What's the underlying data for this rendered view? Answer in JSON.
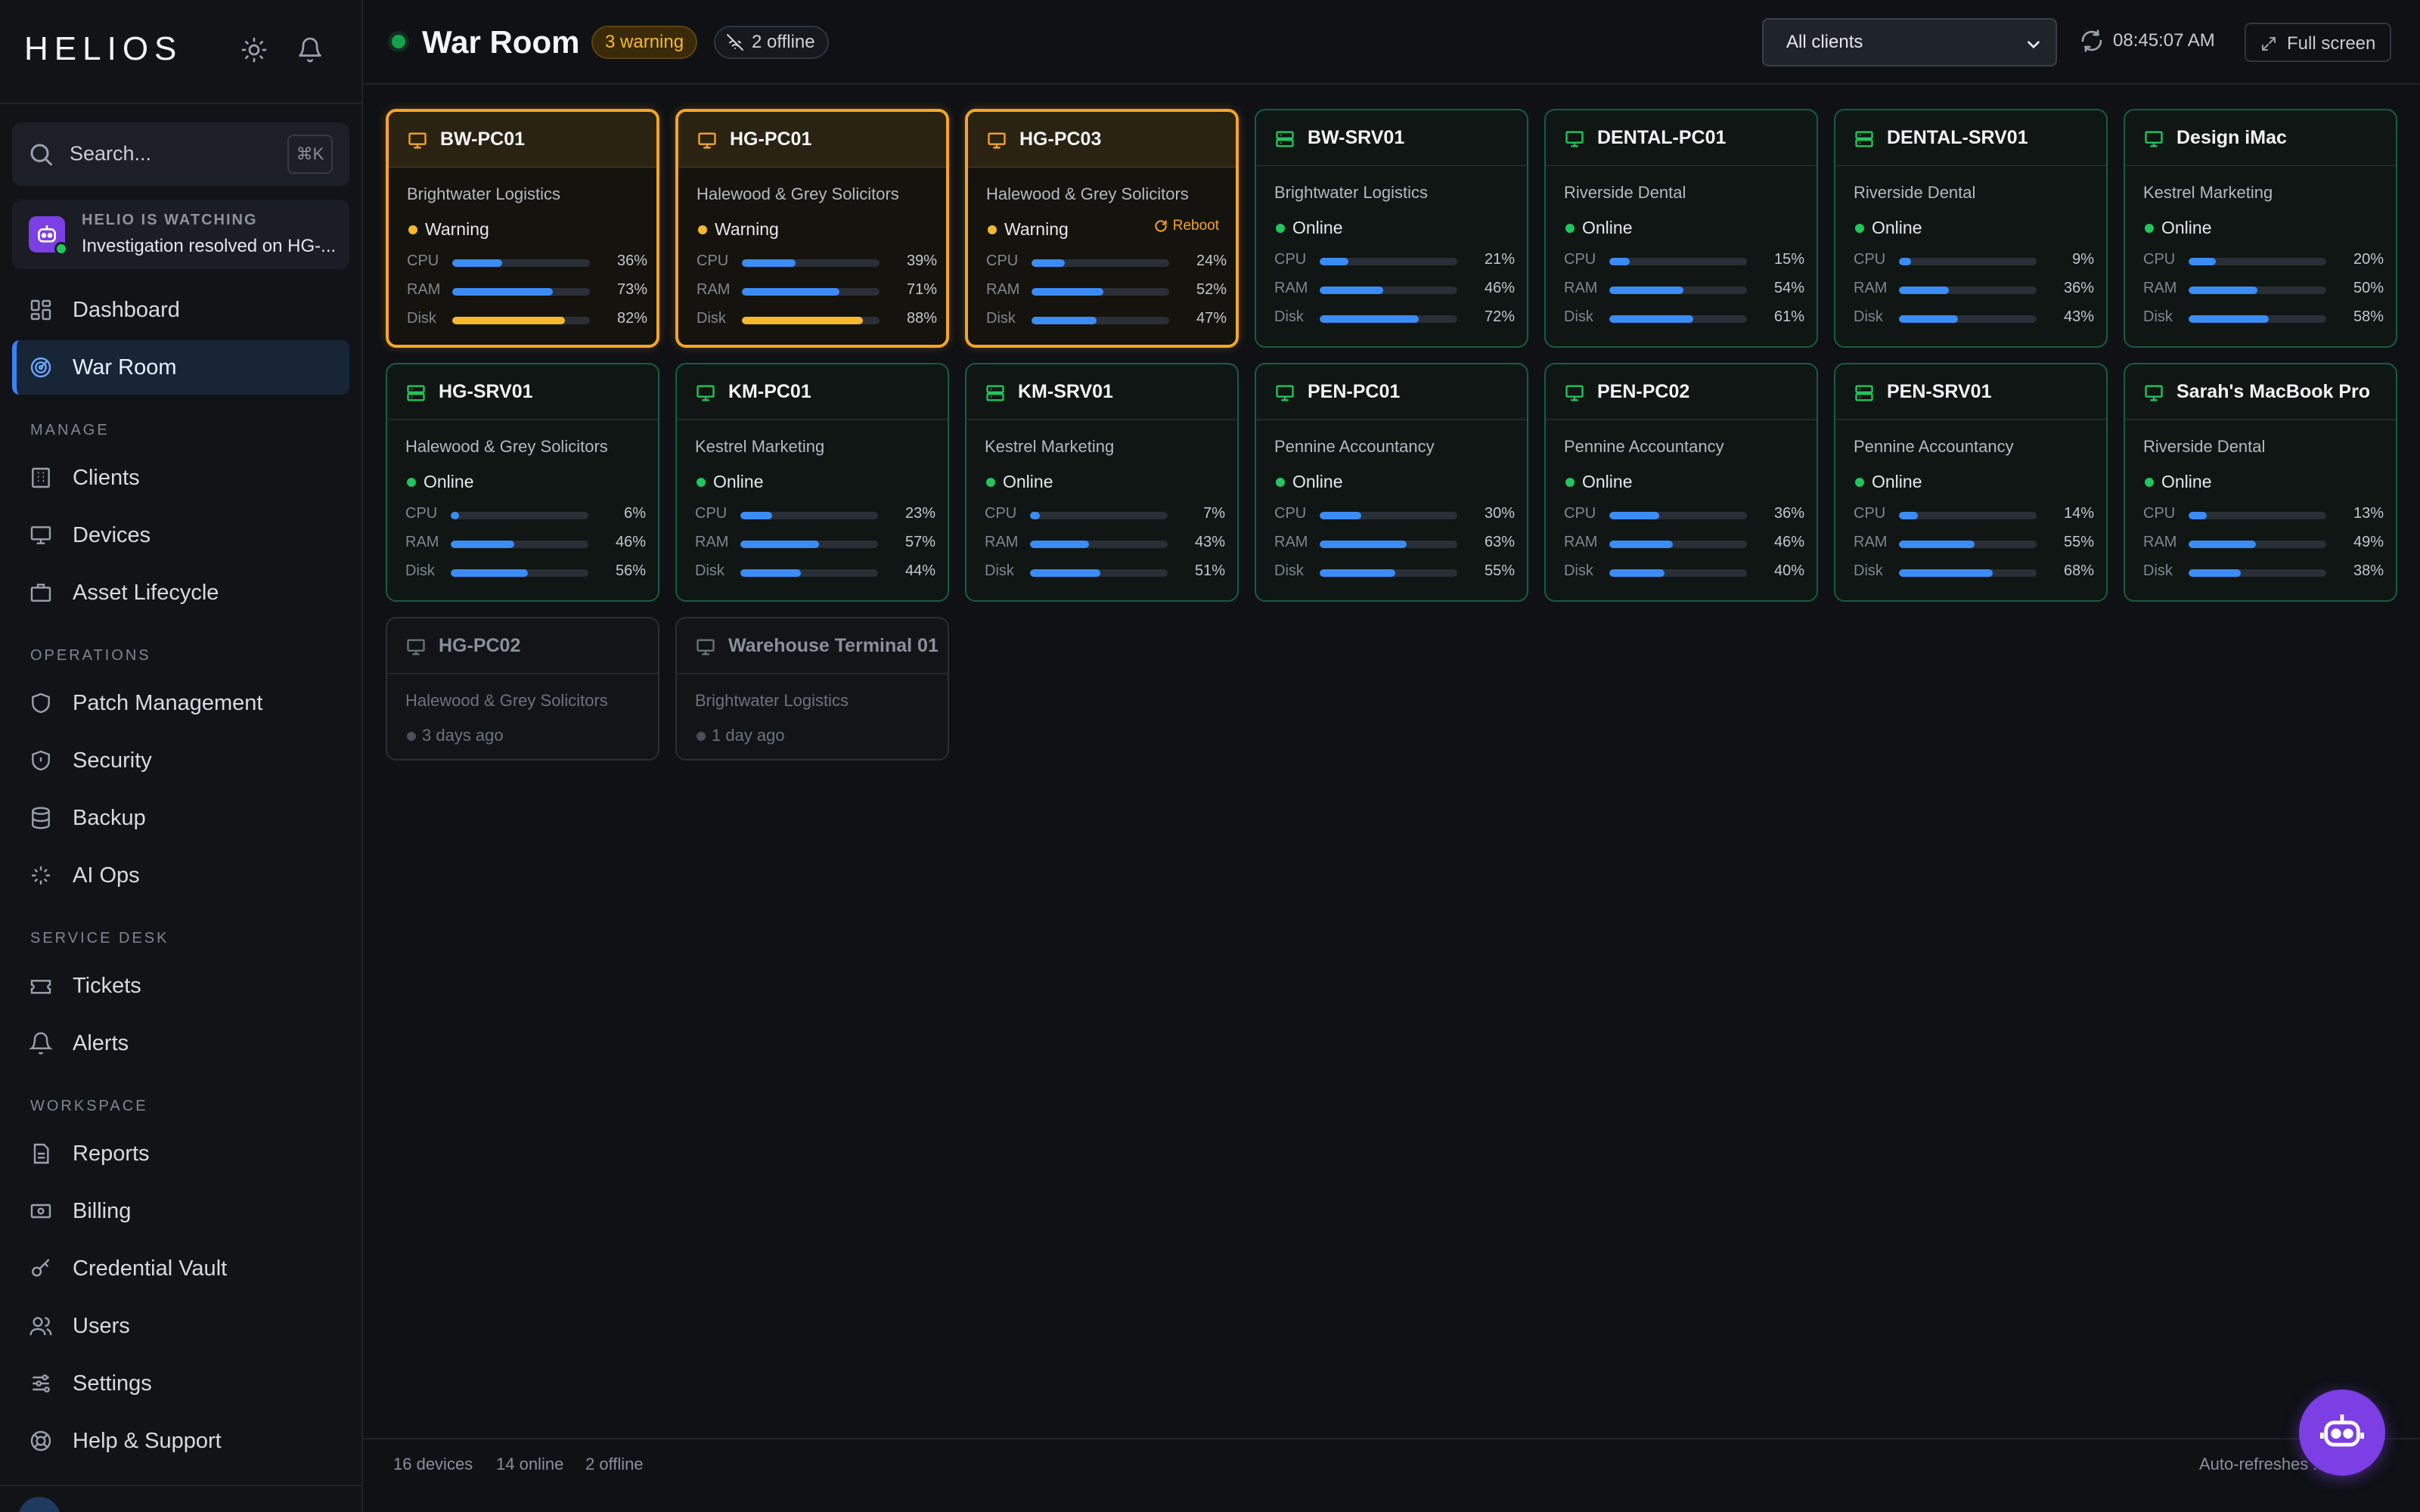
{
  "app": {
    "logo": "HELIOS"
  },
  "search": {
    "placeholder": "Search...",
    "shortcut": "⌘K"
  },
  "watch": {
    "title": "HELIO IS WATCHING",
    "text": "Investigation resolved on HG-..."
  },
  "nav": {
    "dashboard": "Dashboard",
    "war_room": "War Room",
    "manage_head": "MANAGE",
    "clients": "Clients",
    "devices": "Devices",
    "asset_lifecycle": "Asset Lifecycle",
    "operations_head": "OPERATIONS",
    "patch": "Patch Management",
    "security": "Security",
    "backup": "Backup",
    "ai_ops": "AI Ops",
    "service_head": "SERVICE DESK",
    "tickets": "Tickets",
    "alerts": "Alerts",
    "workspace_head": "WORKSPACE",
    "reports": "Reports",
    "billing": "Billing",
    "vault": "Credential Vault",
    "users": "Users",
    "settings": "Settings",
    "help": "Help & Support"
  },
  "header": {
    "title": "War Room",
    "warning_badge": "3 warning",
    "offline_badge": "2 offline",
    "client_filter": "All clients",
    "clock": "08:45:07 AM",
    "fullscreen": "Full screen"
  },
  "labels": {
    "cpu": "CPU",
    "ram": "RAM",
    "disk": "Disk",
    "reboot": "Reboot"
  },
  "devices": [
    {
      "name": "BW-PC01",
      "kind": "desktop",
      "client": "Brightwater Logistics",
      "status": "Warning",
      "state": "warning",
      "cpu": 36,
      "ram": 73,
      "disk": 82
    },
    {
      "name": "HG-PC01",
      "kind": "desktop",
      "client": "Halewood & Grey Solicitors",
      "status": "Warning",
      "state": "warning",
      "cpu": 39,
      "ram": 71,
      "disk": 88
    },
    {
      "name": "HG-PC03",
      "kind": "desktop",
      "client": "Halewood & Grey Solicitors",
      "status": "Warning",
      "state": "warning",
      "cpu": 24,
      "ram": 52,
      "disk": 47,
      "reboot": true
    },
    {
      "name": "BW-SRV01",
      "kind": "server",
      "client": "Brightwater Logistics",
      "status": "Online",
      "state": "online",
      "cpu": 21,
      "ram": 46,
      "disk": 72
    },
    {
      "name": "DENTAL-PC01",
      "kind": "desktop",
      "client": "Riverside Dental",
      "status": "Online",
      "state": "online",
      "cpu": 15,
      "ram": 54,
      "disk": 61
    },
    {
      "name": "DENTAL-SRV01",
      "kind": "server",
      "client": "Riverside Dental",
      "status": "Online",
      "state": "online",
      "cpu": 9,
      "ram": 36,
      "disk": 43
    },
    {
      "name": "Design iMac",
      "kind": "desktop",
      "client": "Kestrel Marketing",
      "status": "Online",
      "state": "online",
      "cpu": 20,
      "ram": 50,
      "disk": 58
    },
    {
      "name": "HG-SRV01",
      "kind": "server",
      "client": "Halewood & Grey Solicitors",
      "status": "Online",
      "state": "online",
      "cpu": 6,
      "ram": 46,
      "disk": 56
    },
    {
      "name": "KM-PC01",
      "kind": "desktop",
      "client": "Kestrel Marketing",
      "status": "Online",
      "state": "online",
      "cpu": 23,
      "ram": 57,
      "disk": 44
    },
    {
      "name": "KM-SRV01",
      "kind": "server",
      "client": "Kestrel Marketing",
      "status": "Online",
      "state": "online",
      "cpu": 7,
      "ram": 43,
      "disk": 51
    },
    {
      "name": "PEN-PC01",
      "kind": "desktop",
      "client": "Pennine Accountancy",
      "status": "Online",
      "state": "online",
      "cpu": 30,
      "ram": 63,
      "disk": 55
    },
    {
      "name": "PEN-PC02",
      "kind": "desktop",
      "client": "Pennine Accountancy",
      "status": "Online",
      "state": "online",
      "cpu": 36,
      "ram": 46,
      "disk": 40
    },
    {
      "name": "PEN-SRV01",
      "kind": "server",
      "client": "Pennine Accountancy",
      "status": "Online",
      "state": "online",
      "cpu": 14,
      "ram": 55,
      "disk": 68
    },
    {
      "name": "Sarah's MacBook Pro",
      "kind": "desktop",
      "client": "Riverside Dental",
      "status": "Online",
      "state": "online",
      "cpu": 13,
      "ram": 49,
      "disk": 38
    },
    {
      "name": "HG-PC02",
      "kind": "desktop",
      "client": "Halewood & Grey Solicitors",
      "status": "3 days ago",
      "state": "offline"
    },
    {
      "name": "Warehouse Terminal 01",
      "kind": "desktop",
      "client": "Brightwater Logistics",
      "status": "1 day ago",
      "state": "offline"
    }
  ],
  "footer": {
    "devices": "16 devices",
    "online": "14 online",
    "offline": "2 offline",
    "auto": "Auto-refreshes ... s"
  },
  "colors": {
    "accent": "#3b82f6",
    "warning": "#f5a524",
    "online": "#22c55e",
    "bot": "#7b3fe4"
  }
}
